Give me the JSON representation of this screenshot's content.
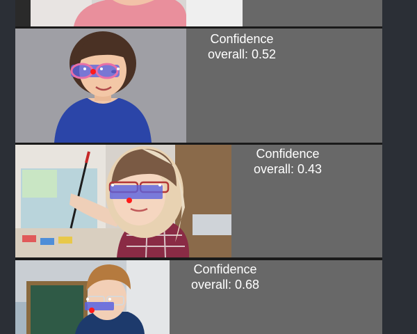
{
  "colors": {
    "card_bg": "#686868",
    "page_bg": "#2b2f36",
    "separator": "#1a1a1a",
    "landmark_box": "#5a63e0",
    "landmark_point": "#ff1a1a"
  },
  "results": [
    {
      "confidence_label": "Confidence",
      "confidence_value": "overall: 0.52"
    },
    {
      "confidence_label": "Confidence",
      "confidence_value": "overall: 0.43"
    },
    {
      "confidence_label": "Confidence",
      "confidence_value": "overall: 0.68"
    }
  ]
}
